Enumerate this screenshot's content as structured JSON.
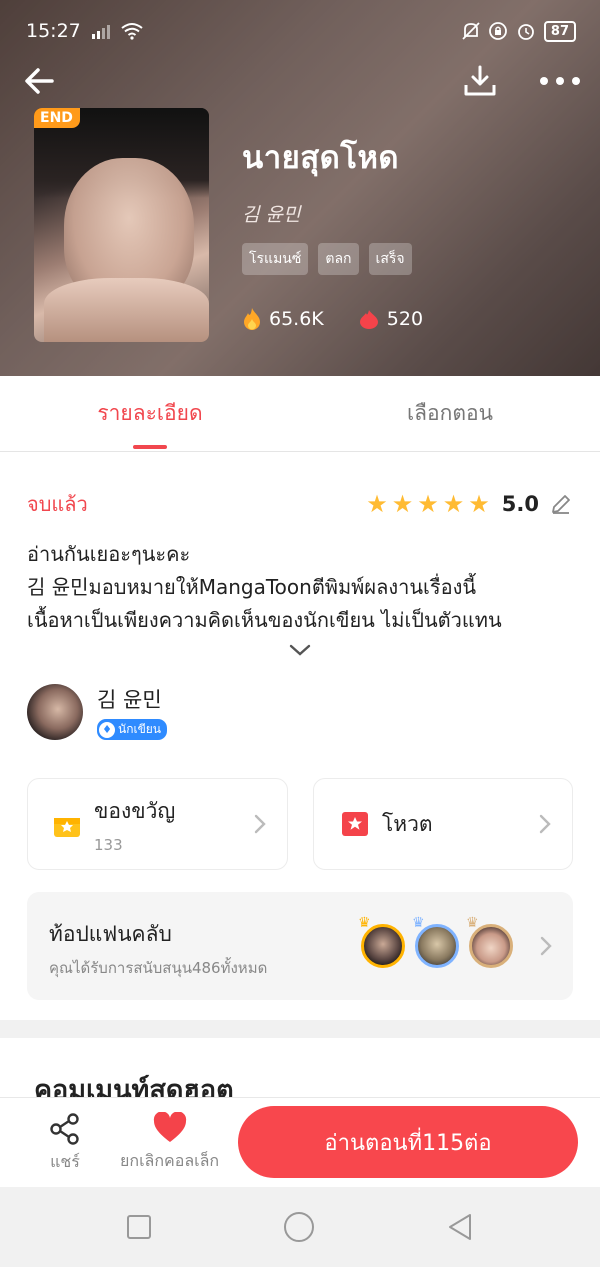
{
  "status_bar": {
    "time": "15:27",
    "battery": "87"
  },
  "header": {
    "end_badge": "END",
    "title": "นายสุดโหด",
    "author": "김 윤민",
    "tags": [
      "โรแมนซ์",
      "ตลก",
      "เสร็จ"
    ],
    "views": "65.6K",
    "likes": "520"
  },
  "tabs": [
    {
      "label": "รายละเอียด",
      "active": true
    },
    {
      "label": "เลือกตอน",
      "active": false
    }
  ],
  "detail": {
    "status": "จบแล้ว",
    "rating_stars": 5,
    "rating_score": "5.0",
    "description_lines": [
      "อ่านกันเยอะๆนะคะ",
      "김 윤민มอบหมายให้MangaToonตีพิมพ์ผลงานเรื่องนี้",
      "เนื้อหาเป็นเพียงความคิดเห็นของนักเขียน ไม่เป็นตัวแทน"
    ]
  },
  "author_section": {
    "name": "김 윤민",
    "badge": "นักเขียน"
  },
  "gift": {
    "label": "ของขวัญ",
    "count": "133"
  },
  "vote": {
    "label": "โหวต"
  },
  "fan_club": {
    "title": "ท้อปแฟนคลับ",
    "subtitle": "คุณได้รับการสนับสนุน486ทั้งหมด"
  },
  "comments": {
    "title": "คอมเมนท์สดฮอต"
  },
  "bottom_bar": {
    "share_label": "แชร์",
    "uncollect_label": "ยกเลิกคอลเล็ก",
    "read_button": "อ่านตอนที่115ต่อ"
  },
  "colors": {
    "accent": "#f1474e",
    "star": "#ffbb33",
    "badge": "#ff9a1a"
  }
}
